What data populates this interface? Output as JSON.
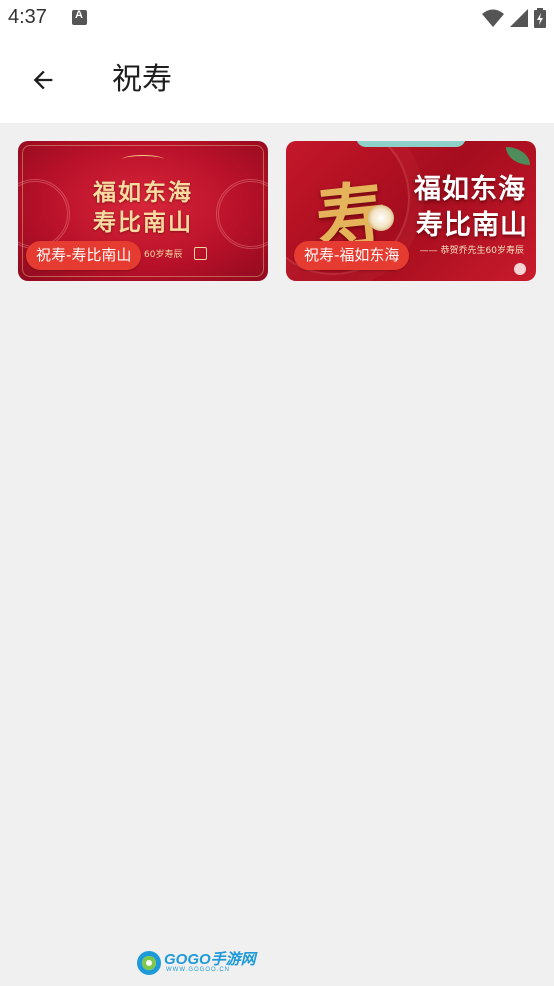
{
  "status_bar": {
    "time": "4:37",
    "notification_icon": "text-a-icon",
    "icons": [
      "wifi-icon",
      "cell-signal-icon",
      "battery-charging-icon"
    ]
  },
  "app_bar": {
    "back_icon": "arrow-left-icon",
    "title": "祝寿"
  },
  "templates": [
    {
      "label": "祝寿-寿比南山",
      "banner_line_1": "福如东海",
      "banner_line_2": "寿比南山",
      "banner_caption": "60岁寿辰",
      "colors": {
        "background": "#b9112a",
        "text": "#f6dca0"
      }
    },
    {
      "label": "祝寿-福如东海",
      "banner_big_char": "寿",
      "banner_line_1": "福如东海",
      "banner_line_2": "寿比南山",
      "banner_caption": "—— 恭贺乔先生60岁寿辰",
      "colors": {
        "background": "#a50d1e",
        "text": "#ffffff"
      }
    }
  ],
  "chip_color": "#e63b30",
  "watermark": {
    "brand": "GOGO手游网",
    "url": "WWW.GOGOO.CN"
  }
}
